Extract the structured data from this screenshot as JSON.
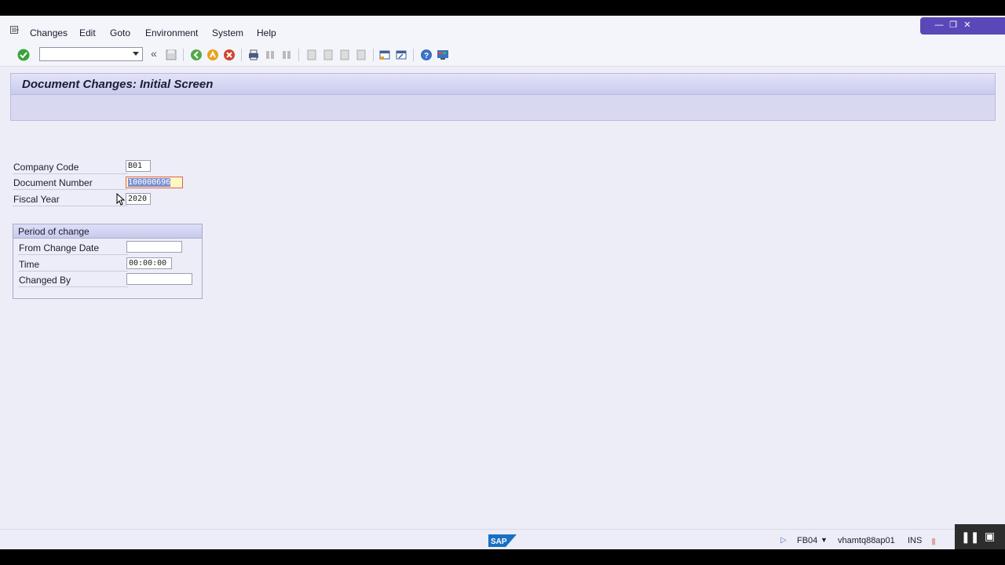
{
  "menu": {
    "items": [
      "Changes",
      "Edit",
      "Goto",
      "Environment",
      "System",
      "Help"
    ]
  },
  "toolbar": {
    "command_field_value": "",
    "icons": [
      "enter-check-icon",
      "back-double-chevron-icon",
      "save-icon",
      "back-icon",
      "exit-icon",
      "cancel-icon",
      "print-icon",
      "find-icon",
      "find-next-icon",
      "first-page-icon",
      "previous-page-icon",
      "next-page-icon",
      "last-page-icon",
      "create-session-icon",
      "shortcut-icon",
      "help-icon",
      "customize-layout-icon"
    ]
  },
  "window_controls": [
    "minimize-icon",
    "restore-icon",
    "close-icon"
  ],
  "page": {
    "title": "Document Changes: Initial Screen"
  },
  "form": {
    "company_code_label": "Company Code",
    "company_code_value": "B01",
    "document_number_label": "Document Number",
    "document_number_value": "100000696",
    "fiscal_year_label": "Fiscal Year",
    "fiscal_year_value": "2020"
  },
  "period_group": {
    "title": "Period of change",
    "from_change_date_label": "From Change Date",
    "from_change_date_value": "",
    "time_label": "Time",
    "time_value": "00:00:00",
    "changed_by_label": "Changed By",
    "changed_by_value": ""
  },
  "status_bar": {
    "logo": "SAP",
    "transaction": "FB04",
    "server": "vhamtq88ap01",
    "mode": "INS"
  },
  "colors": {
    "accent": "#5a48b8",
    "background": "#ecedf7",
    "focus_field": "#fff7c2"
  }
}
